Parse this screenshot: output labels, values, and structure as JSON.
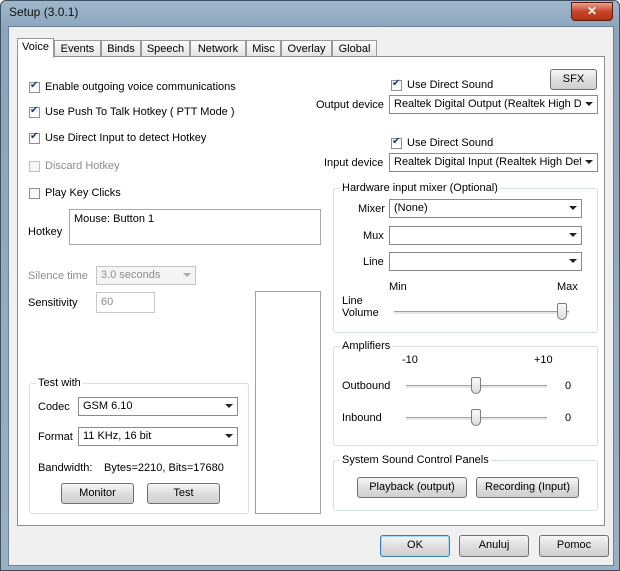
{
  "window": {
    "title": "Setup (3.0.1)",
    "close_glyph": "✕"
  },
  "tabs": [
    "Voice",
    "Events",
    "Binds",
    "Speech",
    "Network",
    "Misc",
    "Overlay",
    "Global"
  ],
  "voice": {
    "enable_outgoing": {
      "label": "Enable outgoing voice communications",
      "checked": true
    },
    "push_to_talk": {
      "label": "Use Push To Talk Hotkey ( PTT Mode )",
      "checked": true
    },
    "direct_input": {
      "label": "Use Direct Input to detect Hotkey",
      "checked": true
    },
    "discard_hotkey": {
      "label": "Discard Hotkey",
      "checked": false,
      "disabled": true
    },
    "play_key_clicks": {
      "label": "Play Key Clicks",
      "checked": false
    },
    "hotkey_label": "Hotkey",
    "hotkey_value": "Mouse: Button 1",
    "silence_time_label": "Silence time",
    "silence_time_value": "3.0 seconds",
    "sensitivity_label": "Sensitivity",
    "sensitivity_value": "60"
  },
  "test_with": {
    "title": "Test with",
    "codec_label": "Codec",
    "codec_value": "GSM 6.10",
    "format_label": "Format",
    "format_value": "11 KHz, 16 bit",
    "bandwidth_label": "Bandwidth:",
    "bandwidth_value": "Bytes=2210, Bits=17680",
    "monitor_button": "Monitor",
    "test_button": "Test"
  },
  "output": {
    "use_direct_sound": {
      "label": "Use Direct Sound",
      "checked": true
    },
    "sfx_button": "SFX",
    "device_label": "Output device",
    "device_value": "Realtek Digital Output (Realtek High Definition Audio)"
  },
  "input": {
    "use_direct_sound": {
      "label": "Use Direct Sound",
      "checked": true
    },
    "device_label": "Input device",
    "device_value": "Realtek Digital Input (Realtek High Definition Audio)"
  },
  "mixer": {
    "title": "Hardware input mixer (Optional)",
    "mixer_label": "Mixer",
    "mixer_value": "(None)",
    "mux_label": "Mux",
    "mux_value": "",
    "line_label": "Line",
    "line_value": "",
    "min_label": "Min",
    "max_label": "Max",
    "line_volume_label_1": "Line",
    "line_volume_label_2": "Volume",
    "line_volume_level": 1.0
  },
  "amplifiers": {
    "title": "Amplifiers",
    "min_label": "-10",
    "max_label": "+10",
    "outbound_label": "Outbound",
    "outbound_value": "0",
    "inbound_label": "Inbound",
    "inbound_value": "0"
  },
  "sound_panels": {
    "title": "System Sound Control Panels",
    "playback_button": "Playback (output)",
    "recording_button": "Recording (Input)"
  },
  "dialog_buttons": {
    "ok": "OK",
    "cancel": "Anuluj",
    "help": "Pomoc"
  }
}
